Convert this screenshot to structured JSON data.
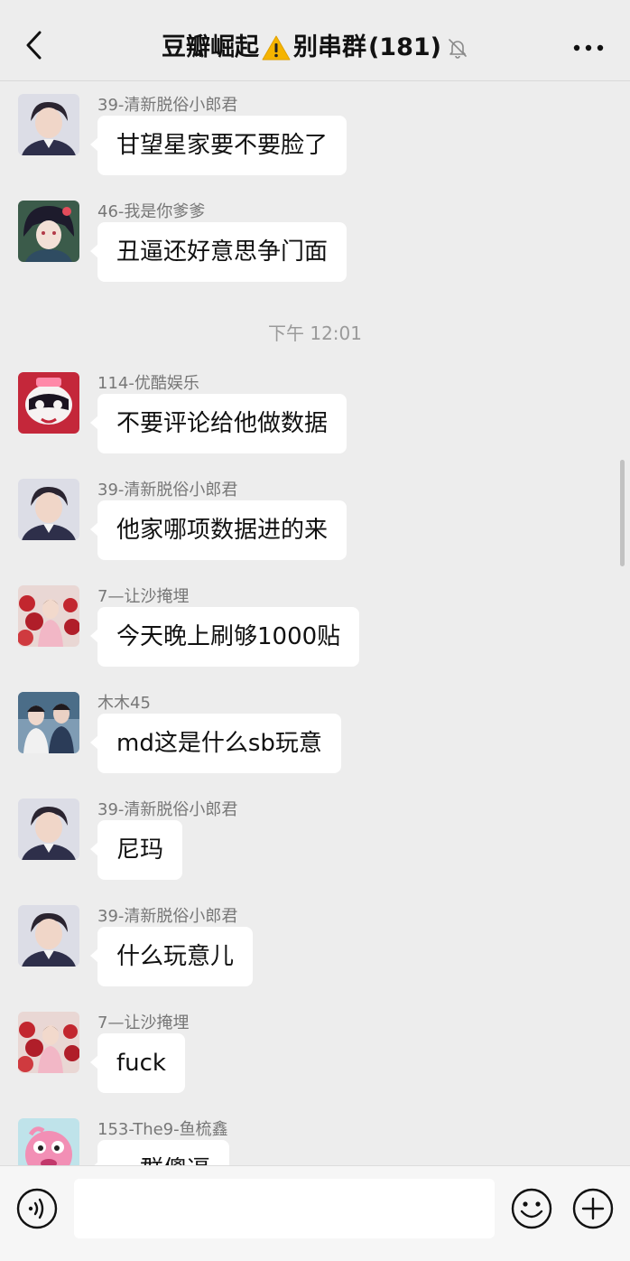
{
  "header": {
    "back_icon": "chevron-left-icon",
    "title_part1": "豆瓣崛起",
    "warning_icon": "warning-emoji-icon",
    "title_part2": "别串群",
    "member_count": "(181)",
    "mute_icon": "bell-muted-icon",
    "more_icon": "more-dots-icon"
  },
  "messages": [
    {
      "sender": "39-清新脱俗小郎君",
      "text": "甘望星家要不要脸了",
      "avatar": "man-portrait-avatar"
    },
    {
      "sender": "46-我是你爹爹",
      "text": "丑逼还好意思争门面",
      "avatar": "anime-character-avatar"
    },
    {
      "sender": "114-优酷娱乐",
      "text": "不要评论给他做数据",
      "avatar": "cartoon-mask-avatar"
    },
    {
      "sender": "39-清新脱俗小郎君",
      "text": "他家哪项数据进的来",
      "avatar": "man-portrait-avatar"
    },
    {
      "sender": "7—让沙掩埋",
      "text": "今天晚上刷够1000贴",
      "avatar": "flowers-portrait-avatar"
    },
    {
      "sender": "木木45",
      "text": "md这是什么sb玩意",
      "avatar": "two-people-avatar"
    },
    {
      "sender": "39-清新脱俗小郎君",
      "text": "尼玛",
      "avatar": "man-portrait-avatar"
    },
    {
      "sender": "39-清新脱俗小郎君",
      "text": "什么玩意儿",
      "avatar": "man-portrait-avatar"
    },
    {
      "sender": "7—让沙掩埋",
      "text": "fuck",
      "avatar": "flowers-portrait-avatar"
    },
    {
      "sender": "153-The9-鱼梳鑫",
      "text": "一群傻逼",
      "avatar": "pink-monster-avatar"
    }
  ],
  "timestamp": "下午 12:01",
  "input_bar": {
    "voice_icon": "voice-icon",
    "input_value": "",
    "emoji_icon": "emoji-smile-icon",
    "plus_icon": "plus-circle-icon"
  },
  "colors": {
    "background": "#ededed",
    "bubble": "#ffffff",
    "sender_text": "#777777",
    "timestamp_text": "#9a9a9a",
    "warning": "#f5b400"
  }
}
